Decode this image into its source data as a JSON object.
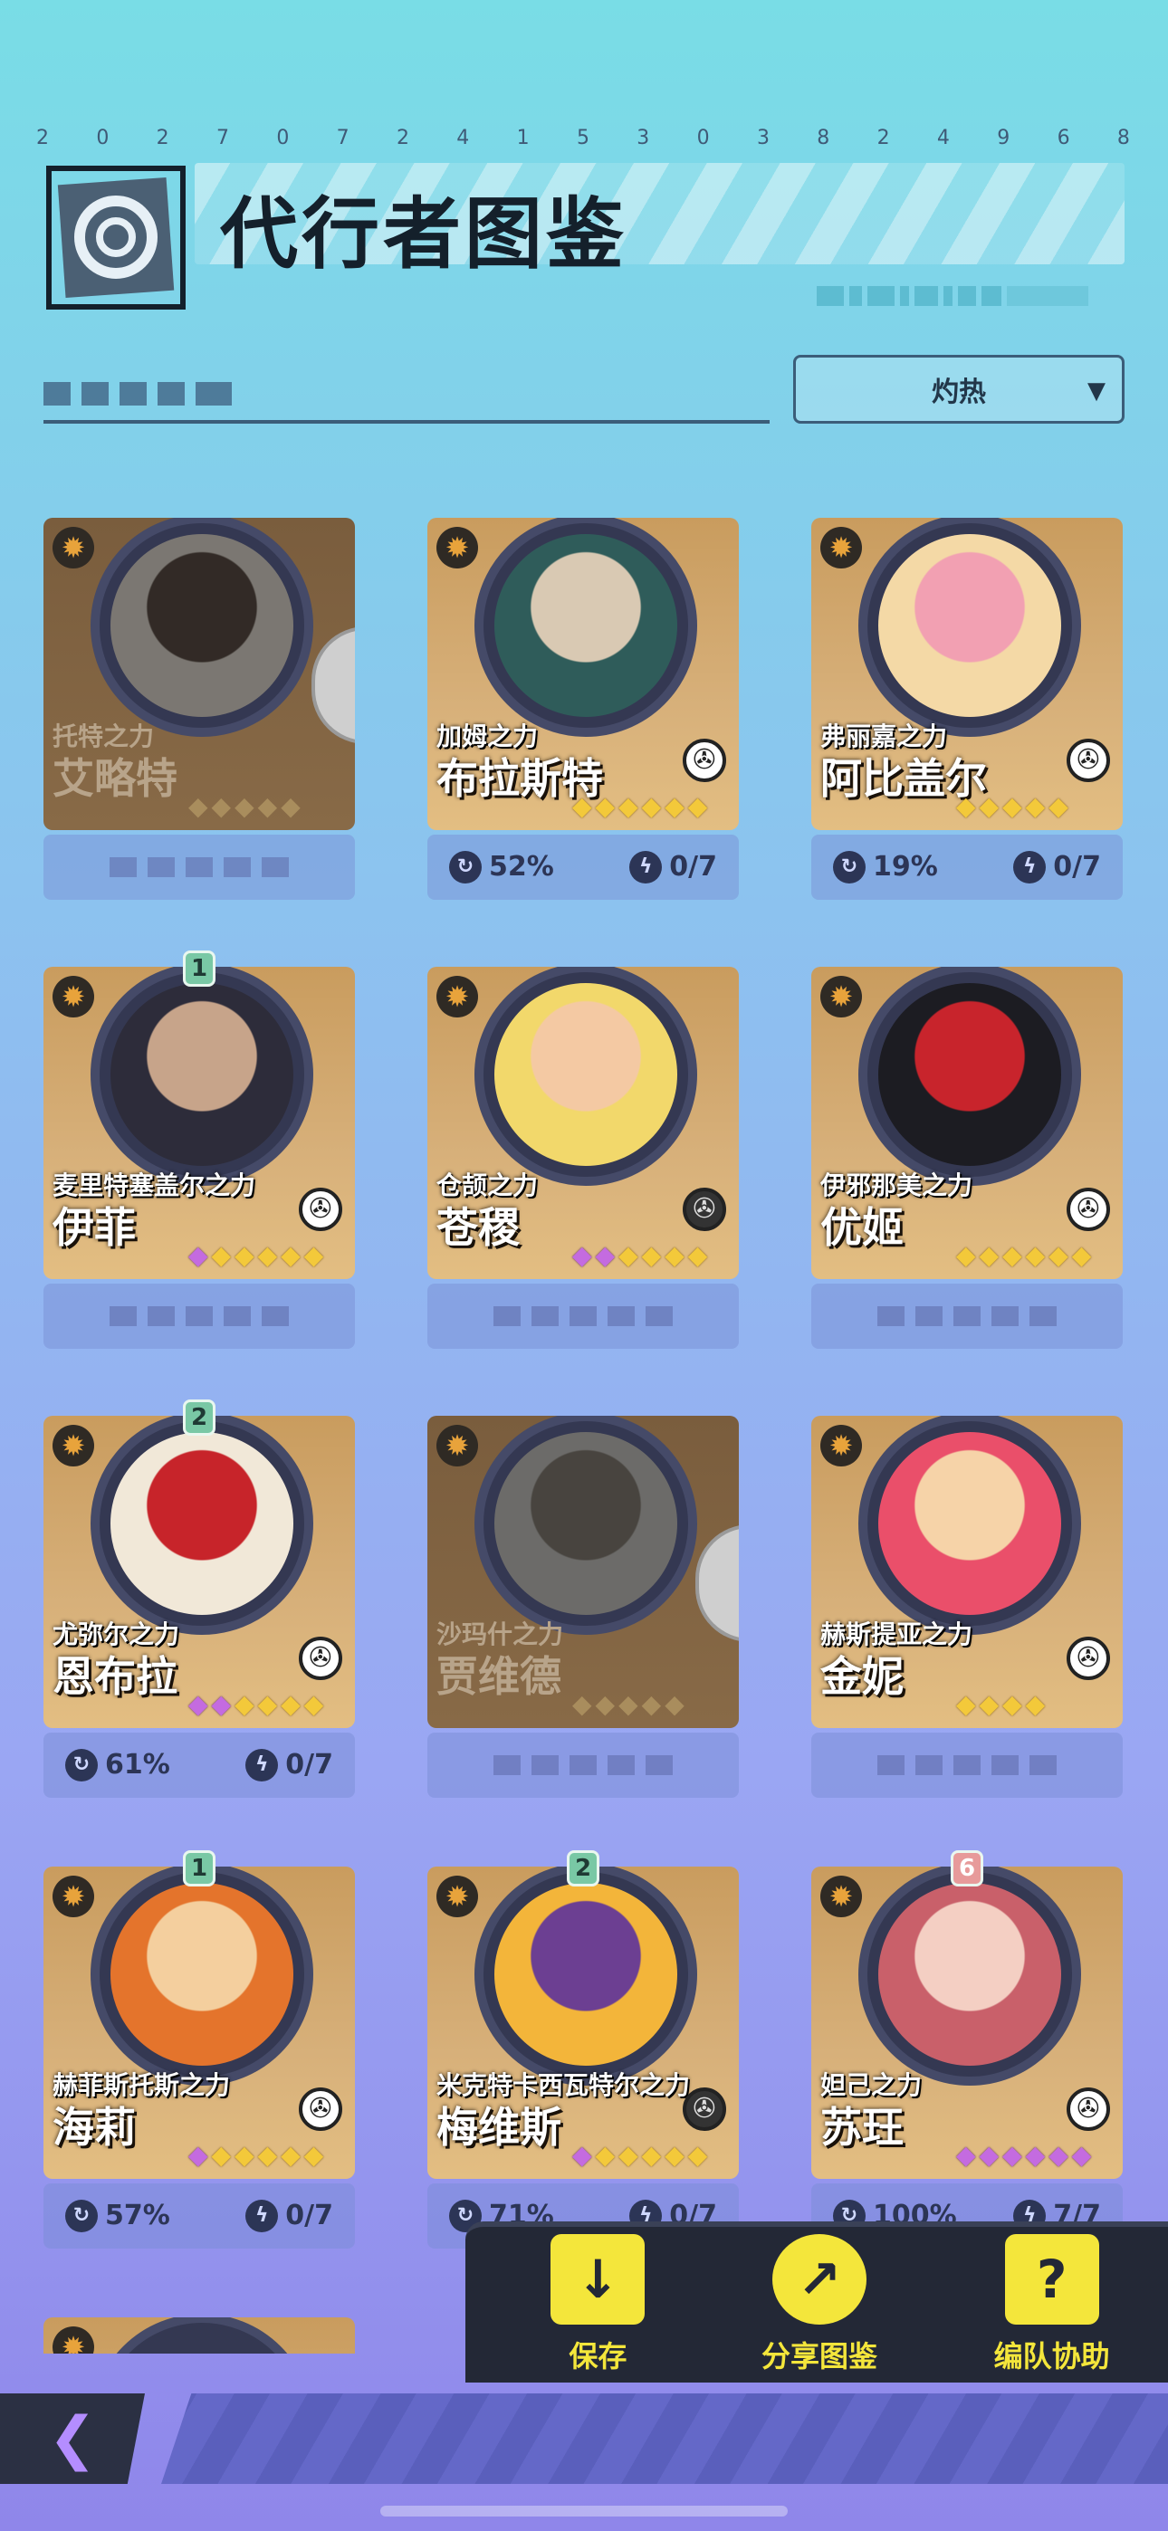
{
  "header": {
    "id_digits": [
      "2",
      "0",
      "2",
      "7",
      "0",
      "7",
      "2",
      "4",
      "1",
      "5",
      "3",
      "0",
      "3",
      "8",
      "2",
      "4",
      "9",
      "6",
      "8"
    ],
    "title": "代行者图鉴"
  },
  "filter": {
    "dropdown_value": "灼热"
  },
  "cards": [
    {
      "power": "托特之力",
      "name": "艾略特",
      "locked": true,
      "badge": "",
      "stats": null,
      "stars_gold": 5,
      "stars_purple": 0
    },
    {
      "power": "加姆之力",
      "name": "布拉斯特",
      "locked": false,
      "badge": "",
      "stats": {
        "progress": "52%",
        "tasks": "0/7"
      },
      "stars_gold": 6,
      "stars_purple": 0
    },
    {
      "power": "弗丽嘉之力",
      "name": "阿比盖尔",
      "locked": false,
      "badge": "",
      "stats": {
        "progress": "19%",
        "tasks": "0/7"
      },
      "stars_gold": 5,
      "stars_purple": 0
    },
    {
      "power": "麦里特塞盖尔之力",
      "name": "伊菲",
      "locked": false,
      "badge": "1",
      "stats": null,
      "stars_gold": 5,
      "stars_purple": 1
    },
    {
      "power": "仓颉之力",
      "name": "苍稷",
      "locked": false,
      "badge": "",
      "stats": null,
      "stars_gold": 4,
      "stars_purple": 2
    },
    {
      "power": "伊邪那美之力",
      "name": "优姬",
      "locked": false,
      "badge": "",
      "stats": null,
      "stars_gold": 6,
      "stars_purple": 0
    },
    {
      "power": "尤弥尔之力",
      "name": "恩布拉",
      "locked": false,
      "badge": "2",
      "stats": {
        "progress": "61%",
        "tasks": "0/7"
      },
      "stars_gold": 4,
      "stars_purple": 2
    },
    {
      "power": "沙玛什之力",
      "name": "贾维德",
      "locked": true,
      "badge": "",
      "stats": null,
      "stars_gold": 5,
      "stars_purple": 0
    },
    {
      "power": "赫斯提亚之力",
      "name": "金妮",
      "locked": false,
      "badge": "",
      "stats": null,
      "stars_gold": 4,
      "stars_purple": 0
    },
    {
      "power": "赫菲斯托斯之力",
      "name": "海莉",
      "locked": false,
      "badge": "1",
      "stats": {
        "progress": "57%",
        "tasks": "0/7"
      },
      "stars_gold": 5,
      "stars_purple": 1
    },
    {
      "power": "米克特卡西瓦特尔之力",
      "name": "梅维斯",
      "locked": false,
      "badge": "2",
      "stats": {
        "progress": "71%",
        "tasks": "0/7"
      },
      "stars_gold": 5,
      "stars_purple": 1
    },
    {
      "power": "妲己之力",
      "name": "苏玨",
      "locked": false,
      "badge": "6",
      "stats": {
        "progress": "100%",
        "tasks": "7/7"
      },
      "stars_gold": 0,
      "stars_purple": 6
    }
  ],
  "actions": {
    "save": "保存",
    "share": "分享图鉴",
    "team": "编队协助"
  },
  "colors": {
    "accent_yellow": "#f4e63b",
    "card_gold": "#d7b07a",
    "dark_panel": "#232836"
  }
}
